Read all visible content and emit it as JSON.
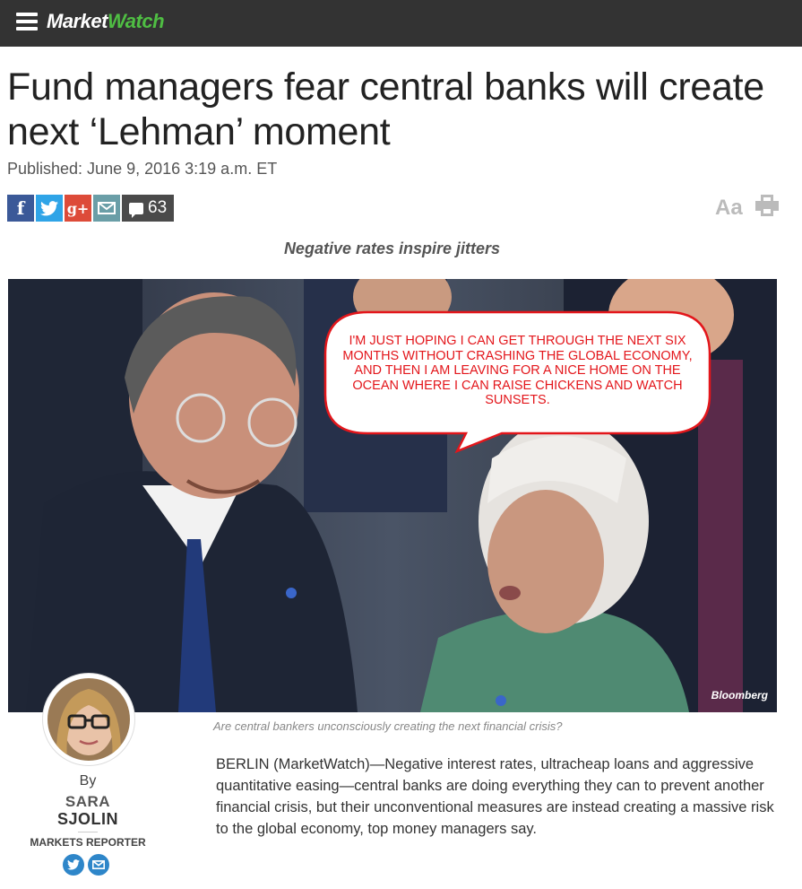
{
  "header": {
    "logo_part1": "Market",
    "logo_part2": "Watch",
    "brand_color": "#4fbe43",
    "bar_color": "#333333"
  },
  "article": {
    "headline": "Fund managers fear central banks will create next ‘Lehman’ moment",
    "published": "Published: June 9, 2016 3:19 a.m. ET",
    "subhead": "Negative rates inspire jitters",
    "photo_credit": "Bloomberg",
    "speech_bubble": "I'M JUST HOPING I CAN GET THROUGH THE NEXT SIX MONTHS WITHOUT CRASHING THE GLOBAL ECONOMY, AND THEN I AM LEAVING FOR A NICE HOME  ON THE OCEAN WHERE I CAN RAISE CHICKENS AND WATCH SUNSETS.",
    "caption": "Are central bankers unconsciously creating the next financial crisis?",
    "body": "BERLIN (MarketWatch)—Negative interest rates, ultracheap loans and aggressive quantitative easing—central banks are doing everything they can to prevent another financial crisis, but their unconventional measures are instead creating a massive risk to the global economy, top money managers say."
  },
  "share": {
    "facebook": "f",
    "googleplus": "g+",
    "comment_count": "63",
    "icons": [
      "facebook-icon",
      "twitter-icon",
      "google-plus-icon",
      "email-icon",
      "comment-icon"
    ]
  },
  "tools": {
    "text_size": "Aa",
    "print_icon": "print-icon"
  },
  "author": {
    "by": "By",
    "first_name": "SARA",
    "last_name": "SJOLIN",
    "role": "MARKETS REPORTER"
  }
}
